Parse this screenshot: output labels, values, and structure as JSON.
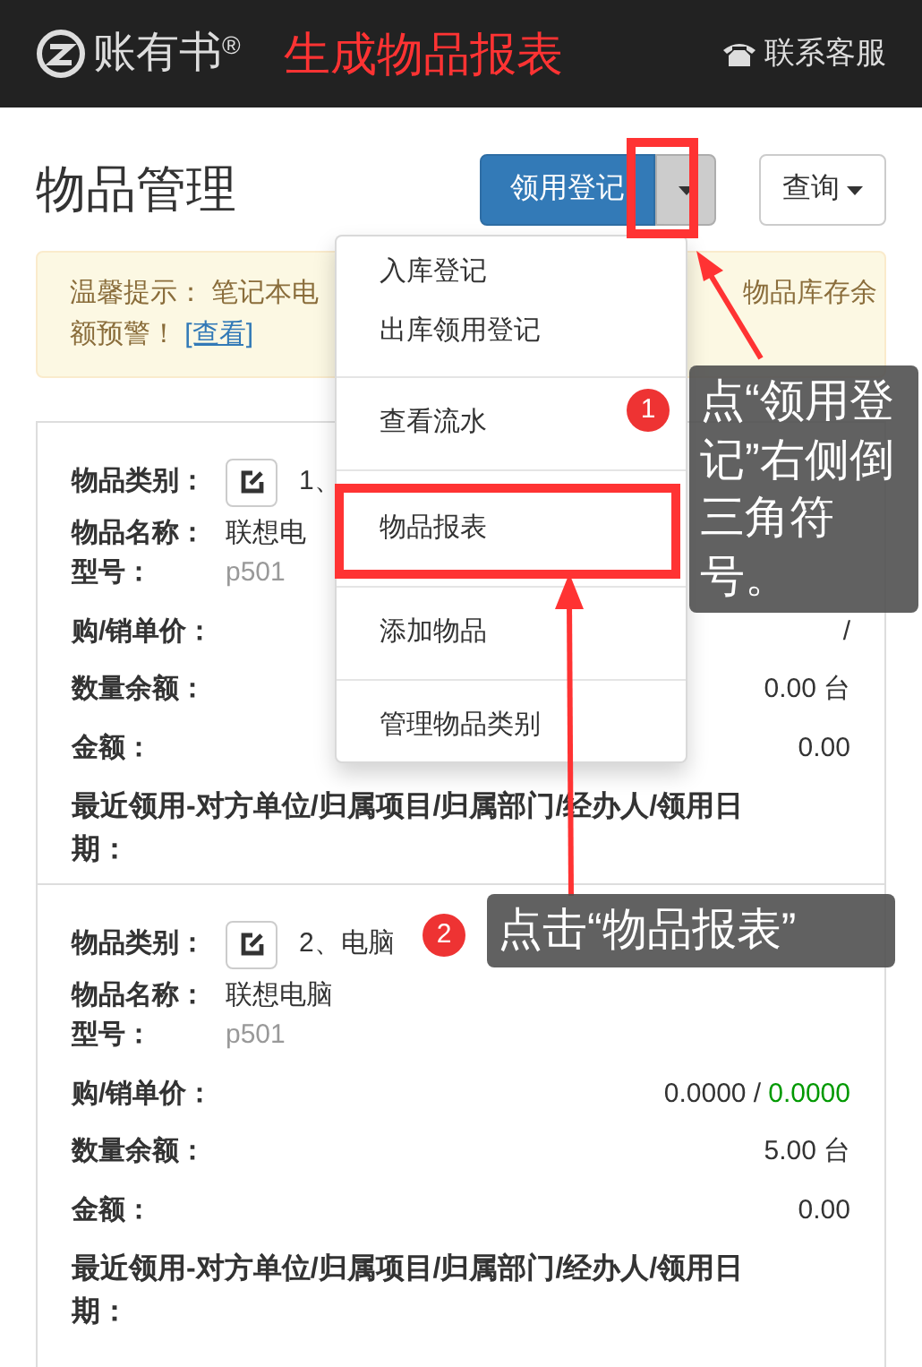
{
  "navbar": {
    "brand": "账有书$^{®}$",
    "annotation_title": "生成物品报表",
    "support": "联系客服"
  },
  "page": {
    "title": "物品管理",
    "primary_button": "领用登记",
    "query_button": "查询"
  },
  "alert": {
    "text": "温馨提示： 笔记本电",
    "text_right": "物品库存余",
    "text_line2": "额预警！",
    "link": "[查看]"
  },
  "cards": [
    {
      "category_label": "物品类别：",
      "category": "1、",
      "name_label": "物品名称：",
      "name": "联想电",
      "model_label": "型号：",
      "model": "p501",
      "price_label": "购/销单价：",
      "price": "/",
      "qty_label": "数量余额：",
      "qty": "0.00",
      "unit": "台",
      "amount_label": "金额：",
      "amount": "0.00",
      "recent_label": "最近领用-对方单位/归属项目/归属部门/经办人/领用日期："
    },
    {
      "category_label": "物品类别：",
      "category": "2、电脑",
      "name_label": "物品名称：",
      "name": "联想电脑",
      "model_label": "型号：",
      "model": "p501",
      "price_label": "购/销单价：",
      "price": "0.0000 /",
      "price_sell": "0.0000",
      "qty_label": "数量余额：",
      "qty": "5.00",
      "unit": "台",
      "amount_label": "金额：",
      "amount": "0.00",
      "recent_label": "最近领用-对方单位/归属项目/归属部门/经办人/领用日期："
    }
  ],
  "dropdown": {
    "groups": [
      [
        {
          "label": "入库登记",
          "selected": false
        },
        {
          "label": "出库领用登记",
          "selected": false
        }
      ],
      [
        {
          "label": "查看流水",
          "selected": false
        }
      ],
      [
        {
          "label": "物品报表",
          "selected": true
        }
      ],
      [
        {
          "label": "添加物品",
          "selected": false
        }
      ],
      [
        {
          "label": "管理物品类别",
          "selected": false
        }
      ]
    ]
  },
  "callouts": [
    {
      "number": "1",
      "text": "点“领用登记”右侧倒三角符号。"
    },
    {
      "number": "2",
      "text": "点击“物品报表”"
    }
  ]
}
